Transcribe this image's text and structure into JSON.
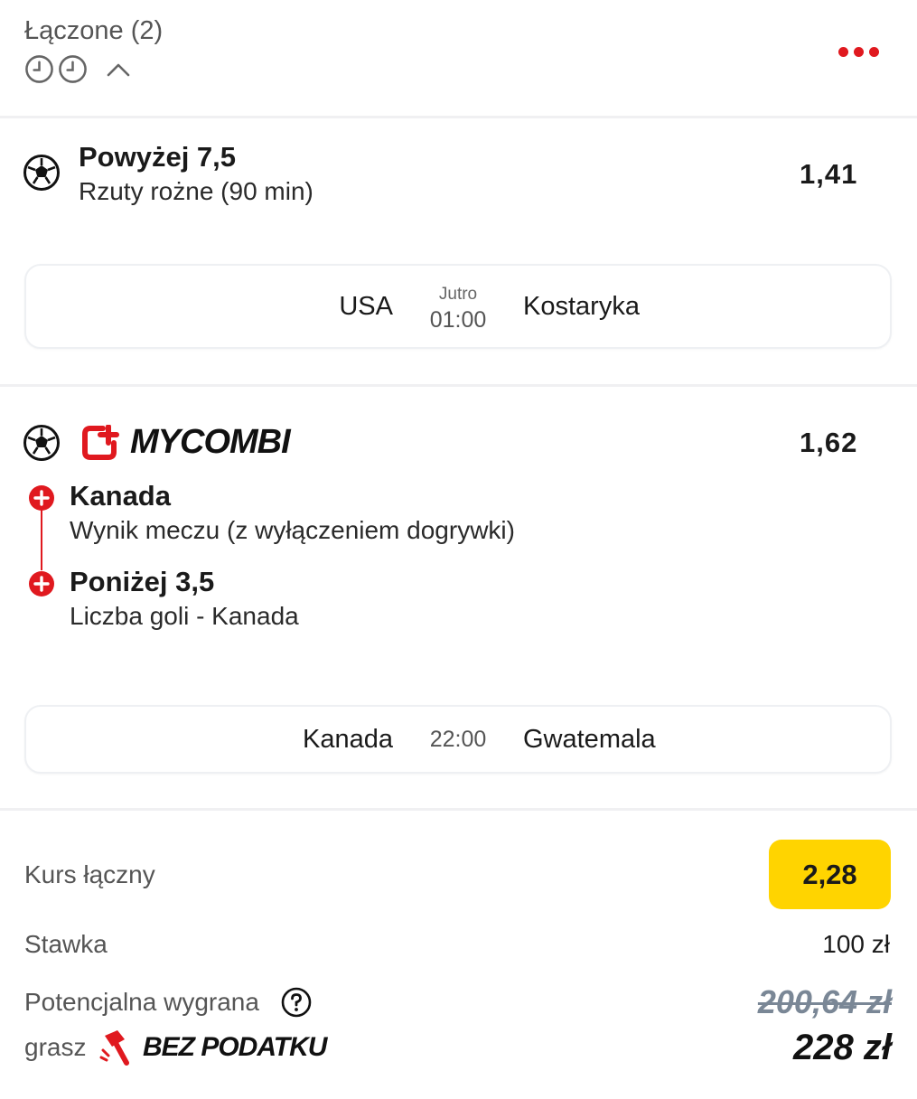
{
  "header": {
    "title": "Łączone (2)"
  },
  "bets": [
    {
      "title": "Powyżej 7,5",
      "subtitle": "Rzuty rożne (90 min)",
      "odds": "1,41",
      "match": {
        "home": "USA",
        "time_label": "Jutro",
        "time": "01:00",
        "away": "Kostaryka"
      }
    },
    {
      "brand": "MYCOMBI",
      "odds": "1,62",
      "legs": [
        {
          "title": "Kanada",
          "subtitle": "Wynik meczu (z wyłączeniem dogrywki)"
        },
        {
          "title": "Poniżej 3,5",
          "subtitle": "Liczba goli - Kanada"
        }
      ],
      "match": {
        "home": "Kanada",
        "time": "22:00",
        "away": "Gwatemala"
      }
    }
  ],
  "summary": {
    "total_odds_label": "Kurs łączny",
    "total_odds": "2,28",
    "stake_label": "Stawka",
    "stake": "100 zł",
    "potential_win_label": "Potencjalna wygrana",
    "potential_win_old": "200,64 zł",
    "play_label": "grasz",
    "no_tax_label": "BEZ PODATKU",
    "potential_win_new": "228 zł"
  },
  "colors": {
    "accent_red": "#e0191f",
    "badge_yellow": "#ffd400",
    "muted_text": "#555555"
  }
}
